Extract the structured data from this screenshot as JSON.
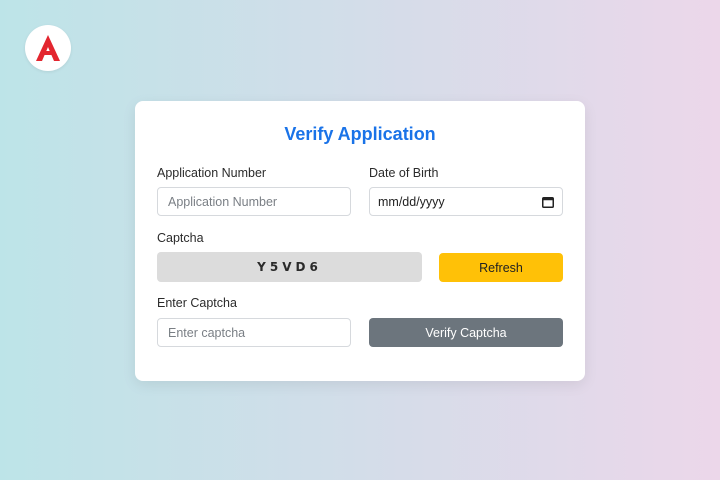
{
  "logo": {
    "icon": "brand-a-logo-icon",
    "color": "#e3262f"
  },
  "form": {
    "title": "Verify Application",
    "title_color": "#1a73e8",
    "application_number": {
      "label": "Application Number",
      "placeholder": "Application Number",
      "value": ""
    },
    "date_of_birth": {
      "label": "Date of Birth",
      "display_value": "mm/dd/yyyy",
      "icon": "calendar-icon"
    },
    "captcha": {
      "label": "Captcha",
      "code": "Y5VD6",
      "refresh_label": "Refresh",
      "refresh_color": "#ffc107"
    },
    "enter_captcha": {
      "label": "Enter Captcha",
      "placeholder": "Enter captcha",
      "value": ""
    },
    "verify_button": {
      "label": "Verify Captcha",
      "color": "#6c757d"
    }
  }
}
